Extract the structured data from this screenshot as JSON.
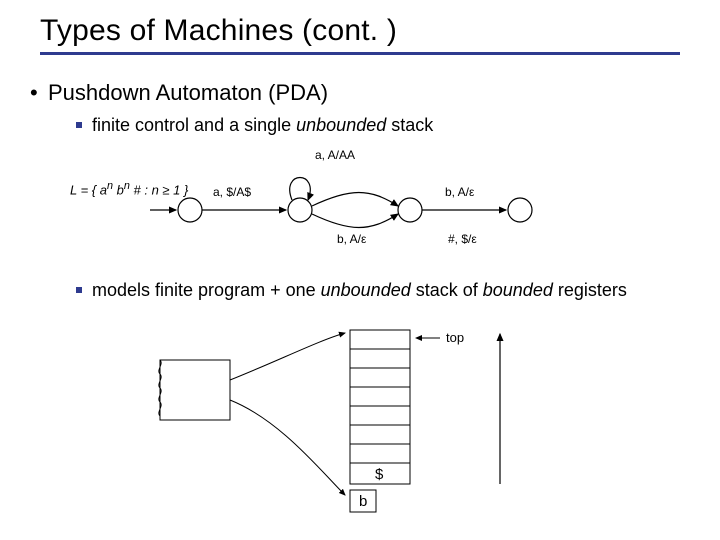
{
  "title": "Types of Machines (cont. )",
  "bullet1": "Pushdown Automaton (PDA)",
  "bullet2a_pre": "finite control and a single ",
  "bullet2a_em": "unbounded",
  "bullet2a_post": " stack",
  "bullet2b_pre": "models finite program + one ",
  "bullet2b_em1": "unbounded",
  "bullet2b_mid": " stack of ",
  "bullet2b_em2": "bounded",
  "bullet2b_post": " registers",
  "lang_lhs": "L = { a",
  "lang_sup1": "n",
  "lang_mid": " b",
  "lang_sup2": "n",
  "lang_rhs": " # : n ≥ 1 }",
  "edge": {
    "loop_q1": "a, A/AA",
    "s_to_q1": "a, $/A$",
    "q1_to_q2_top": "b, A/ε",
    "q1_to_q2_bot": "b, A/ε",
    "q2_to_f": "#, $/ε"
  },
  "stack": {
    "top_label": "top",
    "bottom_symbol": "$",
    "tape_symbol": "b"
  }
}
